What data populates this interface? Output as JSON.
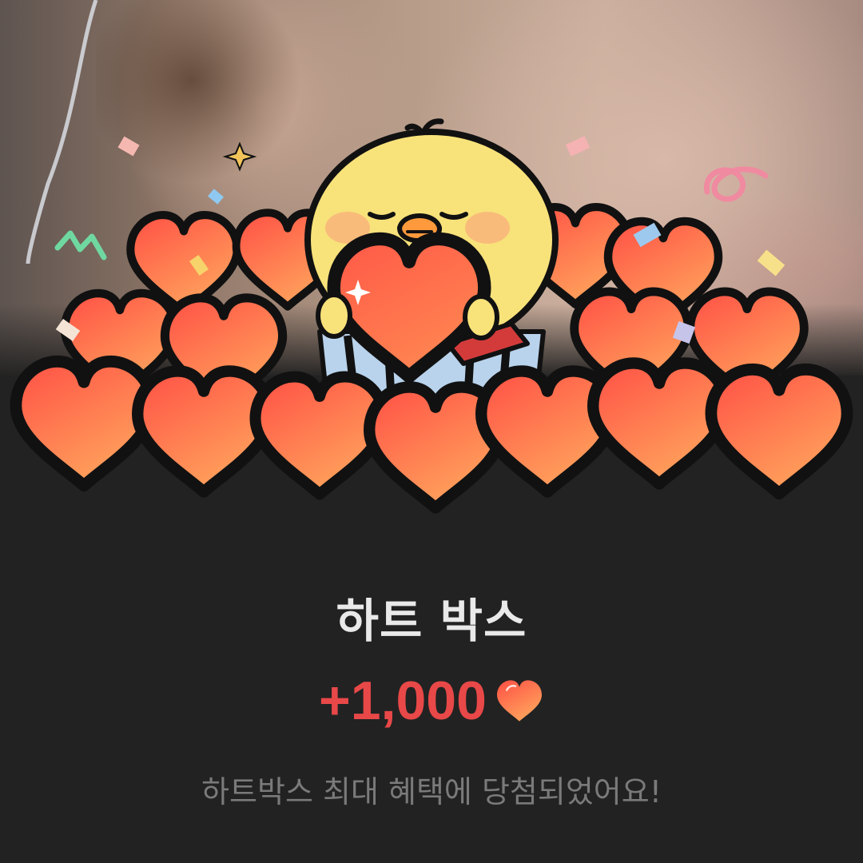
{
  "hero": {
    "background": "photo-of-person-face",
    "character": "yellow-chick-holding-heart-icon",
    "decorations": [
      "confetti",
      "sparkle-icon",
      "heart-pile-icon"
    ]
  },
  "popup": {
    "title": "하트 박스",
    "reward_amount": "+1,000",
    "reward_icon": "heart-icon",
    "message": "하트박스 최대 혜택에 당첨되었어요!"
  },
  "colors": {
    "background": "#222222",
    "title": "#e9e9e9",
    "accent_red": "#e84848",
    "message_gray": "#7a7a7a",
    "heart_top": "#ff5a4a",
    "heart_bottom": "#ffa05a",
    "chick_yellow": "#f8e27a"
  }
}
